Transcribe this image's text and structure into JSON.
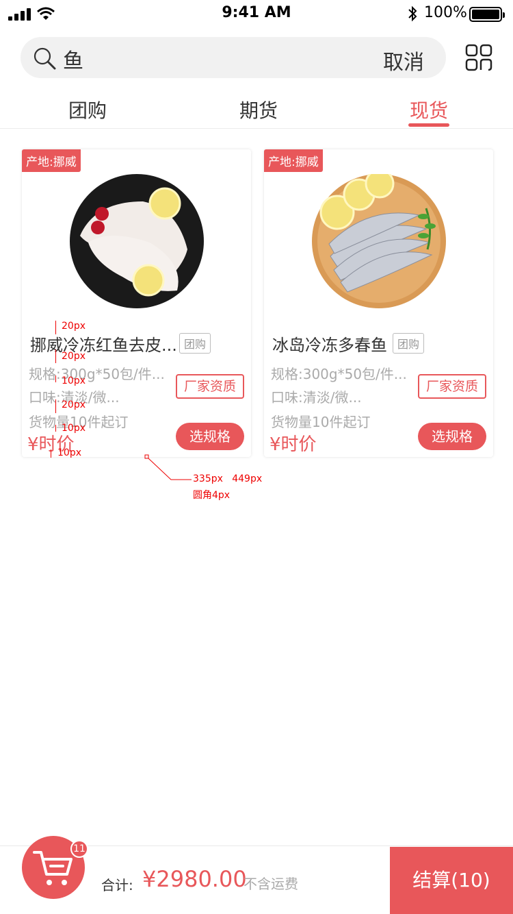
{
  "status_bar": {
    "time": "9:41 AM",
    "battery": "100%"
  },
  "search": {
    "query": "鱼",
    "cancel_label": "取消"
  },
  "tabs": [
    {
      "label": "团购",
      "active": false
    },
    {
      "label": "期货",
      "active": false
    },
    {
      "label": "现货",
      "active": true
    }
  ],
  "products": [
    {
      "origin": "产地:挪威",
      "name": "挪威冷冻红鱼去皮...",
      "tag": "团购",
      "spec": "规格:300g*50包/件...",
      "taste": "口味:清淡/微...",
      "moq": "货物量10件起订",
      "price": "¥时价",
      "qualification_label": "厂家资质",
      "select_label": "选规格",
      "image_icon": "fish-fillet-plate"
    },
    {
      "origin": "产地:挪威",
      "name": "冰岛冷冻多春鱼",
      "tag": "团购",
      "spec": "规格:300g*50包/件...",
      "taste": "口味:清淡/微...",
      "moq": "货物量10件起订",
      "price": "¥时价",
      "qualification_label": "厂家资质",
      "select_label": "选规格",
      "image_icon": "capelin-wooden-board"
    }
  ],
  "annotations": {
    "gap1": "20px",
    "gap2": "20px",
    "gap3": "10px",
    "gap4": "20px",
    "gap5": "10px",
    "gap6": "10px",
    "card_size": "335px   449px",
    "card_radius": "圆角4px"
  },
  "bottom_bar": {
    "cart_count": "11",
    "total_label": "合计:",
    "total": "¥2980.00",
    "shipping_note": "不含运费",
    "checkout_label": "结算(10)"
  },
  "colors": {
    "accent": "#e8575a",
    "muted": "#aaaaaa"
  }
}
